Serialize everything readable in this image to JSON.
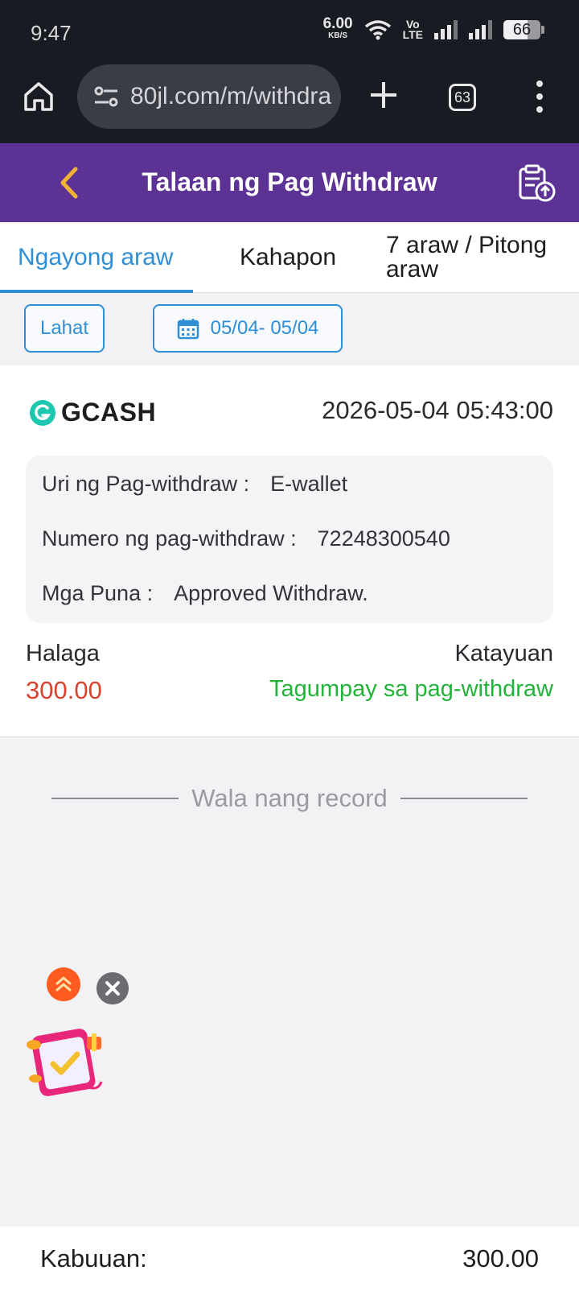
{
  "status_bar": {
    "time": "9:47",
    "net_speed": "6.00",
    "net_unit": "KB/S",
    "volte_top": "Vo",
    "volte_bottom": "LTE",
    "battery": "66"
  },
  "browser": {
    "url": "80jl.com/m/withdra",
    "tab_count": "63"
  },
  "header": {
    "title": "Talaan ng Pag Withdraw"
  },
  "tabs": [
    {
      "label": "Ngayong araw",
      "active": true
    },
    {
      "label": "Kahapon",
      "active": false
    },
    {
      "label": "7 araw / Pitong araw",
      "active": false
    }
  ],
  "filters": {
    "all_label": "Lahat",
    "date_range": "05/04- 05/04"
  },
  "record": {
    "provider": "GCASH",
    "datetime": "2026-05-04 05:43:00",
    "type_label": "Uri ng Pag-withdraw :",
    "type_value": "E-wallet",
    "number_label": "Numero ng pag-withdraw :",
    "number_value": "72248300540",
    "remarks_label": "Mga Puna :",
    "remarks_value": "Approved Withdraw.",
    "amount_label": "Halaga",
    "amount_value": "300.00",
    "status_label": "Katayuan",
    "status_value": "Tagumpay sa pag-withdraw"
  },
  "no_more_text": "Wala nang record",
  "summary": {
    "label": "Kabuuan:",
    "value": "300.00"
  },
  "colors": {
    "header_bg": "#5d3295",
    "accent": "#2f8fd6",
    "amount": "#d9422c",
    "success": "#21b33a"
  }
}
